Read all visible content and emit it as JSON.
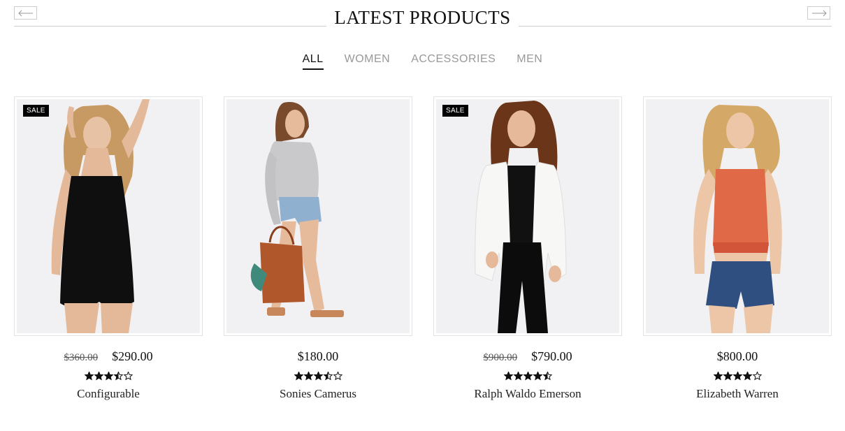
{
  "section": {
    "title": "LATEST PRODUCTS"
  },
  "tabs": [
    {
      "label": "ALL",
      "active": true
    },
    {
      "label": "WOMEN",
      "active": false
    },
    {
      "label": "ACCESSORIES",
      "active": false
    },
    {
      "label": "MEN",
      "active": false
    }
  ],
  "nav": {
    "prev_icon": "arrow-left-icon",
    "next_icon": "arrow-right-icon"
  },
  "products": [
    {
      "badge": "SALE",
      "old_price": "$360.00",
      "price": "$290.00",
      "rating": 3.5,
      "name": "Configurable",
      "image": "woman-black-romper"
    },
    {
      "badge": "",
      "old_price": "",
      "price": "$180.00",
      "rating": 3.5,
      "name": "Sonies Camerus",
      "image": "woman-grey-sweater-denim-shorts"
    },
    {
      "badge": "SALE",
      "old_price": "$900.00",
      "price": "$790.00",
      "rating": 4.5,
      "name": "Ralph Waldo Emerson",
      "image": "woman-white-blazer"
    },
    {
      "badge": "",
      "old_price": "",
      "price": "$800.00",
      "rating": 4,
      "name": "Elizabeth Warren",
      "image": "woman-orange-top-denim-shorts"
    }
  ],
  "colors": {
    "text": "#111111",
    "muted": "#999999",
    "badge_bg": "#000000",
    "image_bg": "#f1f1f3"
  }
}
